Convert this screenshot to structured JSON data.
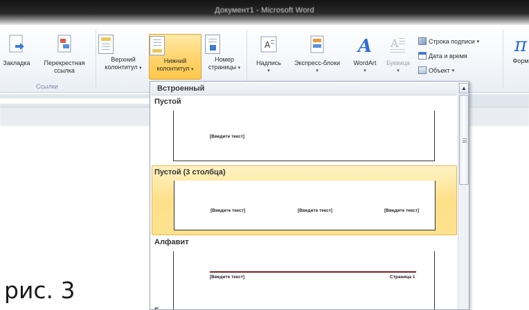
{
  "window": {
    "title": "Документ1 - Microsoft Word"
  },
  "ribbon": {
    "links_group": {
      "label": "Ссылки",
      "bookmark": "Закладка",
      "cross_ref_line1": "Перекрестная",
      "cross_ref_line2": "ссылка"
    },
    "header_footer_group": {
      "header_line1": "Верхний",
      "header_line2": "колонтитул",
      "footer_line1": "Нижний",
      "footer_line2": "колонтитул",
      "page_number_line1": "Номер",
      "page_number_line2": "страницы"
    },
    "text_group": {
      "textbox": "Надпись",
      "quick_parts": "Экспресс-блоки",
      "wordart": "WordArt",
      "dropcap": "Буквица",
      "signature_line": "Строка подписи",
      "date_time": "Дата и время",
      "object": "Объект"
    },
    "symbols_group": {
      "equation": "Форм"
    }
  },
  "gallery": {
    "section_header": "Встроенный",
    "items": [
      {
        "title": "Пустой",
        "placeholders": [
          "[Введите текст]"
        ]
      },
      {
        "title": "Пустой (3 столбца)",
        "placeholders": [
          "[Введите текст]",
          "[Введите текст]",
          "[Введите текст]"
        ]
      },
      {
        "title": "Алфавит",
        "placeholders": [
          "[Введите текст]"
        ],
        "page_label": "Страница 1"
      }
    ],
    "partial_next_title": "Г"
  },
  "caption": "рис. 3",
  "colors": {
    "active_button": "#ffd36b",
    "highlight": "#ffe08a",
    "alphabet_rule": "#7a1f1f"
  }
}
